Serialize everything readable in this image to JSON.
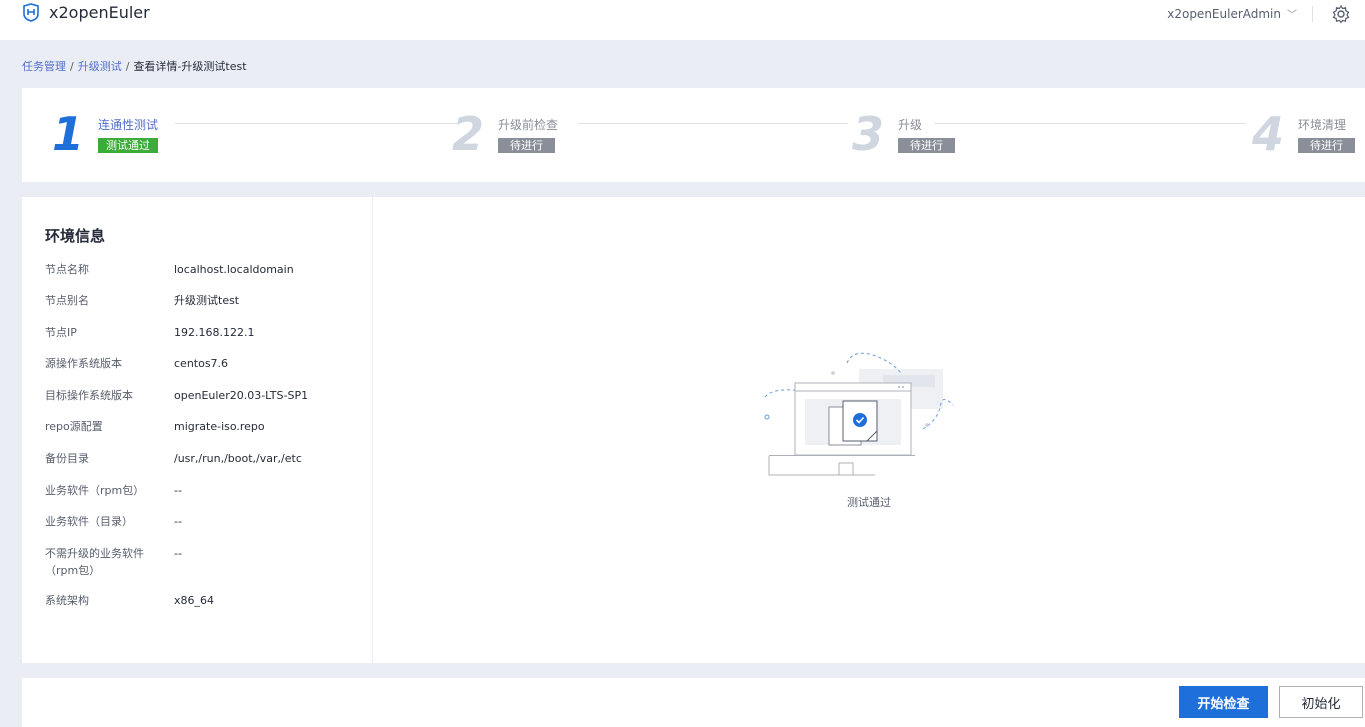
{
  "app": {
    "title": "x2openEuler"
  },
  "header": {
    "user_name": "x2openEulerAdmin"
  },
  "breadcrumb": {
    "items": [
      "任务管理",
      "升级测试",
      "查看详情-升级测试test"
    ]
  },
  "steps": [
    {
      "number": "1",
      "title": "连通性测试",
      "status": "测试通过",
      "active": true
    },
    {
      "number": "2",
      "title": "升级前检查",
      "status": "待进行",
      "active": false
    },
    {
      "number": "3",
      "title": "升级",
      "status": "待进行",
      "active": false
    },
    {
      "number": "4",
      "title": "环境清理",
      "status": "待进行",
      "active": false
    }
  ],
  "env": {
    "title": "环境信息",
    "rows": [
      {
        "label": "节点名称",
        "value": "localhost.localdomain"
      },
      {
        "label": "节点别名",
        "value": "升级测试test"
      },
      {
        "label": "节点IP",
        "value": "192.168.122.1"
      },
      {
        "label": "源操作系统版本",
        "value": "centos7.6"
      },
      {
        "label": "目标操作系统版本",
        "value": "openEuler20.03-LTS-SP1"
      },
      {
        "label": "repo源配置",
        "value": "migrate-iso.repo"
      },
      {
        "label": "备份目录",
        "value": "/usr,/run,/boot,/var,/etc"
      },
      {
        "label": "业务软件（rpm包）",
        "value": "--"
      },
      {
        "label": "业务软件（目录）",
        "value": "--"
      },
      {
        "label": "不需升级的业务软件（rpm包）",
        "value": "--"
      },
      {
        "label": "系统架构",
        "value": "x86_64"
      }
    ]
  },
  "result": {
    "text": "测试通过"
  },
  "footer": {
    "start_check_label": "开始检查",
    "init_label": "初始化"
  },
  "colors": {
    "primary": "#1e6fd9",
    "success": "#3dab3a",
    "pending": "#8a8e99"
  }
}
